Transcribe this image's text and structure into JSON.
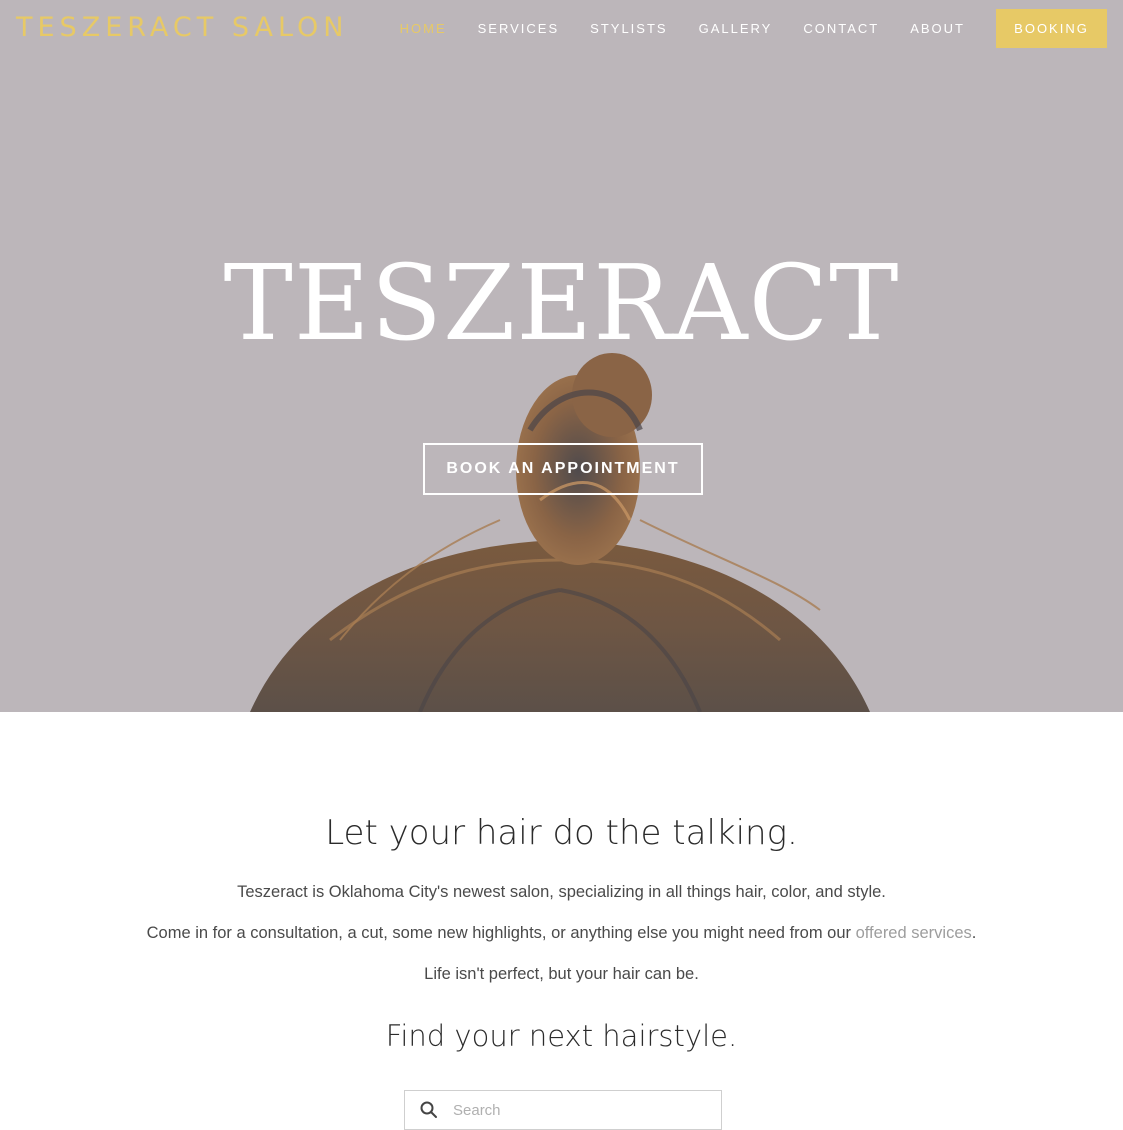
{
  "header": {
    "site_title": "TESZERACT SALON",
    "nav": [
      {
        "label": "HOME",
        "active": true
      },
      {
        "label": "SERVICES",
        "active": false
      },
      {
        "label": "STYLISTS",
        "active": false
      },
      {
        "label": "GALLERY",
        "active": false
      },
      {
        "label": "CONTACT",
        "active": false
      },
      {
        "label": "ABOUT",
        "active": false
      }
    ],
    "booking_label": "BOOKING"
  },
  "hero": {
    "title": "TESZERACT",
    "cta_label": "BOOK AN APPOINTMENT",
    "image": "hair-bun-photo"
  },
  "intro": {
    "heading": "Let your hair do the talking.",
    "p1": "Teszeract is Oklahoma City's newest salon, specializing in all things hair, color, and style.",
    "p2_before": "Come in for a consultation, a cut, some new highlights, or anything else you might need from our ",
    "p2_link": "offered services",
    "p2_after": ".",
    "p3": "Life isn't perfect, but your hair can be.",
    "find_heading": "Find your next hairstyle.",
    "search_placeholder": "Search"
  },
  "colors": {
    "accent": "#e7c966",
    "hero_bg": "#bcb6ba",
    "text": "#2b2b2b",
    "link": "#9d9d9d"
  }
}
